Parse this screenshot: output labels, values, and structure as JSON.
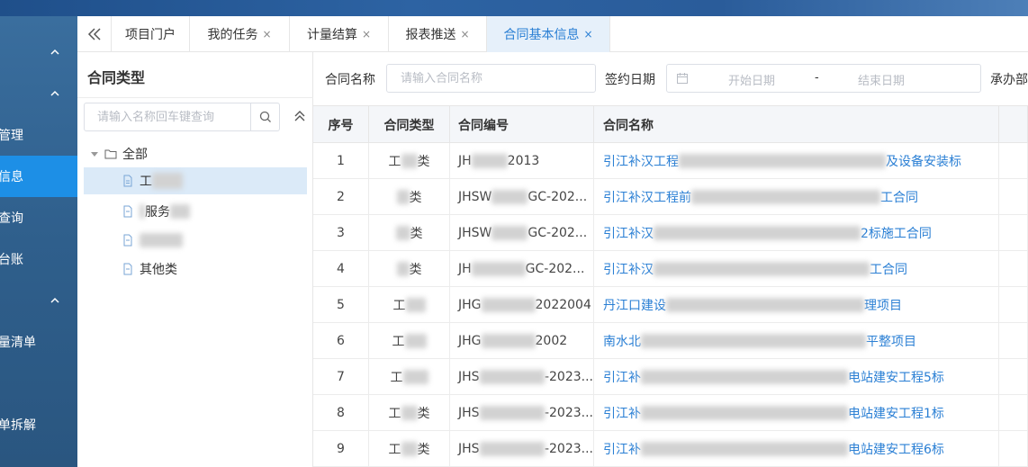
{
  "nav": {
    "items": [
      {
        "label": "",
        "caret": "up"
      },
      {
        "label": "",
        "caret": "up"
      },
      {
        "label": "管理"
      },
      {
        "label": "信息",
        "active": true
      },
      {
        "label": "查询"
      },
      {
        "label": "台账"
      },
      {
        "label": "",
        "caret": "up"
      },
      {
        "label": "量清单"
      },
      {
        "label": "单拆解"
      }
    ]
  },
  "tabs": [
    {
      "label": "项目门户",
      "closable": false
    },
    {
      "label": "我的任务",
      "closable": true
    },
    {
      "label": "计量结算",
      "closable": true
    },
    {
      "label": "报表推送",
      "closable": true
    },
    {
      "label": "合同基本信息",
      "closable": true,
      "active": true
    }
  ],
  "tab_close_glyph": "×",
  "tree": {
    "title": "合同类型",
    "search_placeholder": "请输入名称回车键查询",
    "root_label": "全部",
    "children": [
      "工",
      "服务",
      "",
      "其他类"
    ]
  },
  "filter": {
    "contract_name_label": "合同名称",
    "contract_name_placeholder": "请输入合同名称",
    "sign_date_label": "签约日期",
    "start_placeholder": "开始日期",
    "range_sep": "-",
    "end_placeholder": "结束日期",
    "dept_label": "承办部"
  },
  "table": {
    "headers": [
      "序号",
      "合同类型",
      "合同编号",
      "合同名称"
    ],
    "rows": [
      {
        "seq": "1",
        "type_pre": "工",
        "type_suf": "类",
        "code_pre": "JH",
        "code_suf": "2013",
        "name_pre": "引江补汉工程",
        "name_suf": "及设备安装标"
      },
      {
        "seq": "2",
        "type_pre": "",
        "type_suf": "类",
        "code_pre": "JHSW",
        "code_suf": "GC-202...",
        "name_pre": "引江补汉工程前",
        "name_suf": "工合同"
      },
      {
        "seq": "3",
        "type_pre": "",
        "type_suf": "类",
        "code_pre": "JHSW",
        "code_suf": "GC-202...",
        "name_pre": "引江补汉",
        "name_suf": "2标施工合同"
      },
      {
        "seq": "4",
        "type_pre": "",
        "type_suf": "类",
        "code_pre": "JH",
        "code_suf": "GC-202...",
        "name_pre": "引江补汉",
        "name_suf": "工合同"
      },
      {
        "seq": "5",
        "type_pre": "工",
        "type_suf": "",
        "code_pre": "JHG",
        "code_suf": "2022004",
        "name_pre": "丹江口建设",
        "name_suf": "理项目"
      },
      {
        "seq": "6",
        "type_pre": "工",
        "type_suf": "",
        "code_pre": "JHG",
        "code_suf": "2002",
        "name_pre": "南水北",
        "name_suf": "平整项目"
      },
      {
        "seq": "7",
        "type_pre": "工",
        "type_suf": "",
        "code_pre": "JHS",
        "code_suf": "-2023...",
        "name_pre": "引江补",
        "name_suf": "电站建安工程5标"
      },
      {
        "seq": "8",
        "type_pre": "工",
        "type_suf": "类",
        "code_pre": "JHS",
        "code_suf": "-2023...",
        "name_pre": "引江补",
        "name_suf": "电站建安工程1标"
      },
      {
        "seq": "9",
        "type_pre": "工",
        "type_suf": "类",
        "code_pre": "JHS",
        "code_suf": "-2023...",
        "name_pre": "引江补",
        "name_suf": "电站建安工程6标"
      }
    ]
  },
  "colors": {
    "accent": "#2a7fd4",
    "nav_active": "#1d8fe6",
    "nav_bg": "#2f5f8c"
  }
}
